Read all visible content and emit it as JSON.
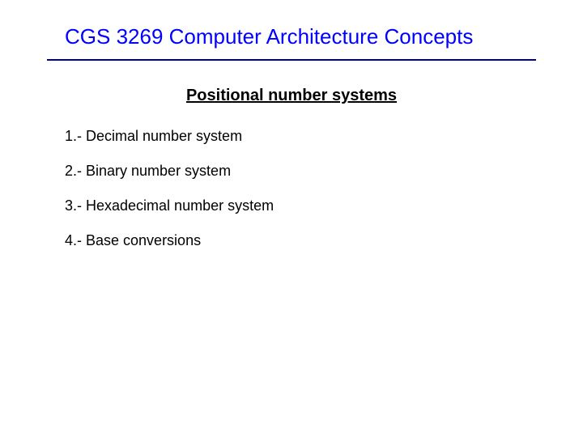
{
  "title": "CGS 3269 Computer Architecture Concepts",
  "subtitle": "Positional number systems",
  "items": [
    "1.- Decimal number system",
    "2.- Binary number system",
    "3.- Hexadecimal number system",
    "4.- Base conversions"
  ]
}
